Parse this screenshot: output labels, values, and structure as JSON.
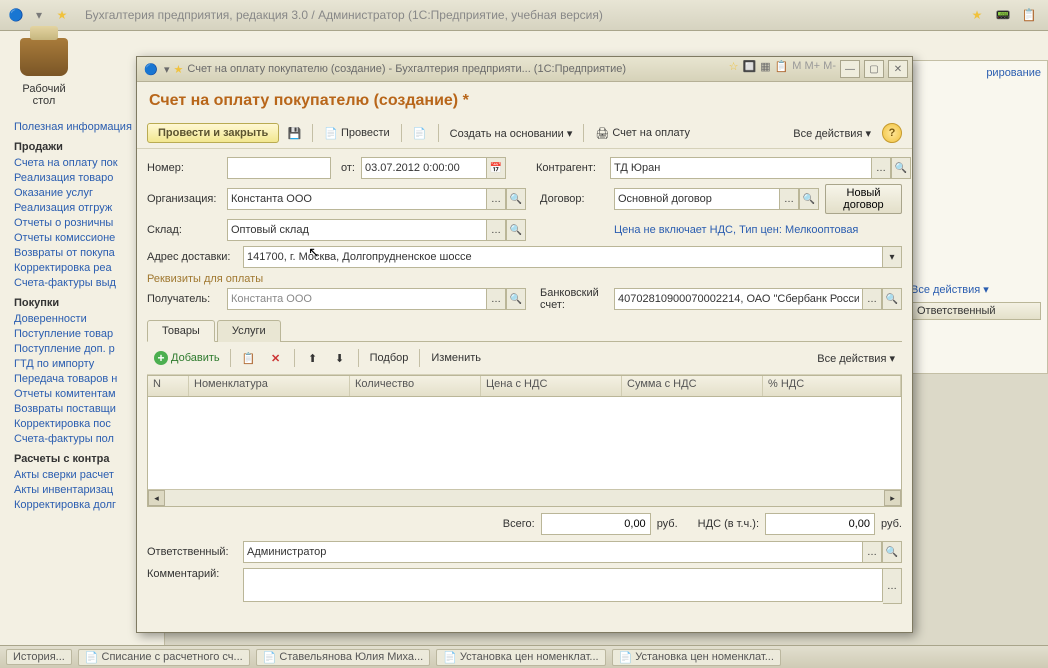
{
  "app_title": "Бухгалтерия предприятия, редакция 3.0 / Администратор   (1С:Предприятие, учебная версия)",
  "desktop_label": "Рабочий\nстол",
  "useful_info": "Полезная информация",
  "right_panel": {
    "admin": "рирование",
    "actions": "Все действия ▾",
    "respons": "Ответственный"
  },
  "sidebar": {
    "sections": [
      {
        "title": "Продажи",
        "items": [
          "Счета на оплату пок",
          "Реализация товаро",
          "Оказание услуг",
          "Реализация отгруж",
          "Отчеты о розничны",
          "Отчеты комиссионе",
          "Возвраты от покупа",
          "Корректировка реа",
          "Счета-фактуры выд"
        ]
      },
      {
        "title": "Покупки",
        "items": [
          "Доверенности",
          "Поступление товар",
          "Поступление доп. р",
          "ГТД по импорту",
          "Передача товаров н",
          "Отчеты комитентам",
          "Возвраты поставщи",
          "Корректировка пос",
          "Счета-фактуры пол"
        ]
      },
      {
        "title": "Расчеты с контра",
        "items": [
          "Акты сверки расчет",
          "Акты инвентаризац",
          "Корректировка долг"
        ]
      }
    ]
  },
  "modal": {
    "title": "Счет на оплату покупателю (создание) - Бухгалтерия предприяти...   (1С:Предприятие)",
    "doc_title": "Счет на оплату покупателю (создание) *",
    "cmd": {
      "post_close": "Провести и закрыть",
      "post": "Провести",
      "create_based": "Создать на основании ▾",
      "invoice": "Счет на оплату",
      "all_actions": "Все действия ▾"
    },
    "fields": {
      "number_lbl": "Номер:",
      "number": "",
      "from_lbl": "от:",
      "date": "03.07.2012 0:00:00",
      "contr_lbl": "Контрагент:",
      "contr": "ТД Юран",
      "org_lbl": "Организация:",
      "org": "Константа ООО",
      "dog_lbl": "Договор:",
      "dog": "Основной договор",
      "new_dog": "Новый договор",
      "sklad_lbl": "Склад:",
      "sklad": "Оптовый склад",
      "price_link": "Цена не включает НДС, Тип цен: Мелкооптовая",
      "addr_lbl": "Адрес доставки:",
      "addr": "141700, г. Москва, Долгопрудненское шоссе",
      "req_group": "Реквизиты для оплаты",
      "recv_lbl": "Получатель:",
      "recv": "Константа ООО",
      "bank_lbl": "Банковский\nсчет:",
      "bank": "40702810900070002214, ОАО \"Сбербанк России\""
    },
    "tabs": {
      "goods": "Товары",
      "services": "Услуги"
    },
    "tab_bar": {
      "add": "Добавить",
      "pick": "Подбор",
      "change": "Изменить",
      "all": "Все действия ▾"
    },
    "grid_cols": {
      "n": "N",
      "nom": "Номенклатура",
      "qty": "Количество",
      "price": "Цена с НДС",
      "sum": "Сумма с НДС",
      "vat": "% НДС"
    },
    "totals": {
      "total_lbl": "Всего:",
      "total": "0,00",
      "rub1": "руб.",
      "vat_lbl": "НДС (в т.ч.):",
      "vat": "0,00",
      "rub2": "руб."
    },
    "resp_lbl": "Ответственный:",
    "resp": "Администратор",
    "comm_lbl": "Комментарий:",
    "comm": ""
  },
  "status": {
    "history": "История...",
    "items": [
      "Списание с расчетного сч...",
      "Ставельянова Юлия Миха...",
      "Установка цен номенклат...",
      "Установка цен номенклат..."
    ]
  }
}
